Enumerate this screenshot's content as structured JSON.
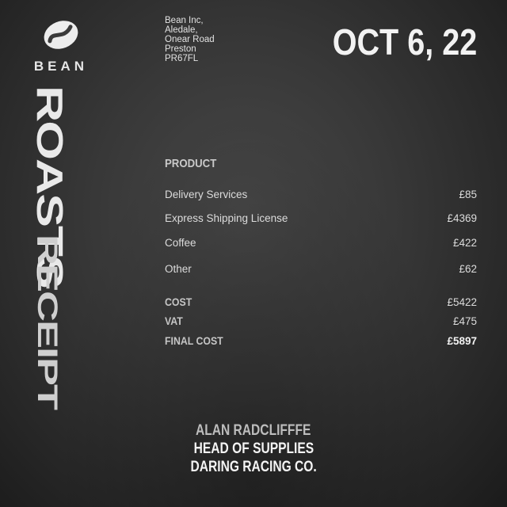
{
  "brand": {
    "logo_icon": "coffee-bean-icon",
    "word": "BEAN",
    "vertical_title": "ROASTS",
    "vertical_subtitle": "RECEIPT"
  },
  "address": {
    "lines": [
      "Bean Inc,",
      "Aledale,",
      "Onear Road",
      "Preston",
      "PR67FL"
    ]
  },
  "date": "OCT 6, 22",
  "table": {
    "heading": "PRODUCT",
    "items": [
      {
        "label": "Delivery Services",
        "amount": "£85"
      },
      {
        "label": "Express Shipping License",
        "amount": "£4369"
      },
      {
        "label": "Coffee",
        "amount": "£422"
      },
      {
        "label": "Other",
        "amount": "£62"
      }
    ],
    "totals": [
      {
        "label": "COST",
        "amount": "£5422"
      },
      {
        "label": "VAT",
        "amount": "£475"
      },
      {
        "label": "FINAL COST",
        "amount": "£5897"
      }
    ]
  },
  "signature": {
    "name": "ALAN RADCLIFFFE",
    "title": "HEAD OF SUPPLIES",
    "company": "DARING RACING CO."
  }
}
